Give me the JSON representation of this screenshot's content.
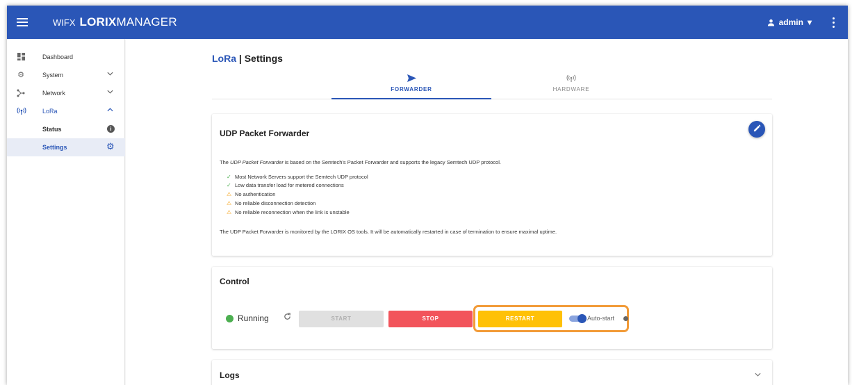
{
  "header": {
    "brand_prefix": "WIFX",
    "brand_bold": "LORIX",
    "brand_rest": "MANAGER",
    "user": "admin",
    "user_caret": "▾",
    "bar_color": "#2a56b7"
  },
  "sidebar": {
    "items": [
      {
        "label": "Dashboard",
        "icon": "dashboard-icon"
      },
      {
        "label": "System",
        "icon": "gear-icon"
      },
      {
        "label": "Network",
        "icon": "network-icon"
      },
      {
        "label": "LoRa",
        "icon": "antenna-icon"
      },
      {
        "label": "Status",
        "icon": "info-icon"
      },
      {
        "label": "Settings",
        "icon": "gear-icon"
      }
    ],
    "info_glyph": "i"
  },
  "page": {
    "title_accent": "LoRa",
    "title_rest": " | Settings"
  },
  "tabs": [
    {
      "label": "FORWARDER",
      "icon": "send-icon",
      "active": true
    },
    {
      "label": "HARDWARE",
      "icon": "antenna-icon",
      "active": false
    }
  ],
  "udp": {
    "title": "UDP Packet Forwarder",
    "intro_pre": "The ",
    "intro_em": "UDP Packet Forwarder",
    "intro_post": " is based on the Semtech's Packet Forwarder and supports the legacy Semtech UDP protocol.",
    "features": [
      {
        "text": "Most Network Servers support the Semtech UDP protocol",
        "type": "ok"
      },
      {
        "text": "Low data transfer load for metered connections",
        "type": "ok"
      },
      {
        "text": "No authentication",
        "type": "warn"
      },
      {
        "text": "No reliable disconnection detection",
        "type": "warn"
      },
      {
        "text": "No reliable reconnection when the link is unstable",
        "type": "warn"
      }
    ],
    "footer": "The UDP Packet Forwarder is monitored by the LORIX OS tools. It will be automatically restarted in case of termination to ensure maximal uptime."
  },
  "control": {
    "title": "Control",
    "status": "Running",
    "start": "START",
    "stop": "STOP",
    "restart": "RESTART",
    "autostart": "Auto-start",
    "autostart_on": true,
    "colors": {
      "running": "#4caf50",
      "stop": "#f2545b",
      "restart": "#ffc107",
      "highlight": "#f29b38"
    }
  },
  "logs": {
    "title": "Logs"
  }
}
